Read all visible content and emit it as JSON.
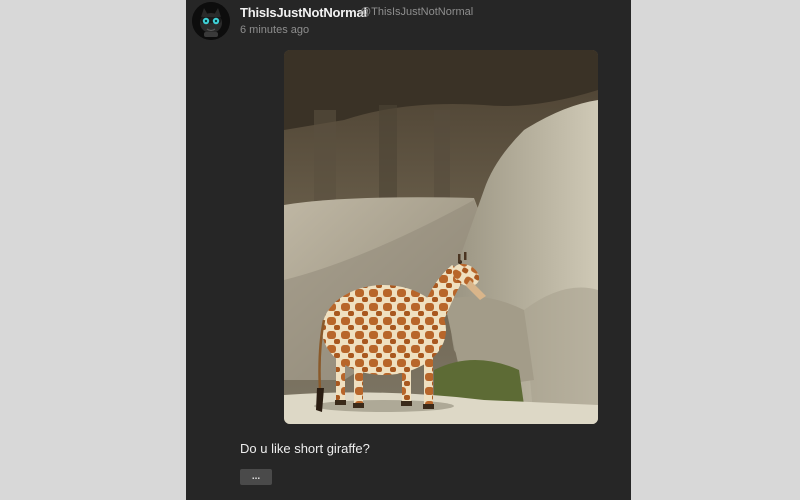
{
  "post": {
    "author": {
      "display_name": "ThisIsJustNotNormal",
      "handle": "@ThisIsJustNotNormal",
      "avatar_icon": "masked-cat-avatar"
    },
    "timestamp": "6 minutes ago",
    "media": {
      "image_icon": "photo-short-giraffe"
    },
    "caption": "Do u like short giraffe?",
    "more_label": "..."
  },
  "colors": {
    "page_background": "#d8d8d8",
    "post_background": "#262626",
    "more_button": "#4a4a4a"
  }
}
